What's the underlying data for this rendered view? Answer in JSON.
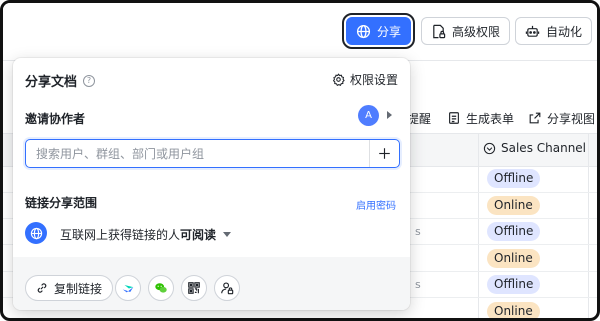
{
  "toolbar": {
    "share_label": "分享",
    "advanced_permissions_label": "高级权限",
    "automation_label": "自动化"
  },
  "table_toolbar": {
    "remind_partial": "提醒",
    "generate_form_label": "生成表单",
    "share_view_label": "分享视图"
  },
  "table": {
    "column_header": "Sales Channel",
    "rows": [
      "Offline",
      "Online",
      "Offline",
      "Online",
      "Offline",
      "Online"
    ],
    "left_fragments": [
      "s",
      "s"
    ]
  },
  "share_panel": {
    "title": "分享文档",
    "help_glyph": "?",
    "permission_settings_label": "权限设置",
    "invite_label": "邀请协作者",
    "avatar_initial": "A",
    "search_placeholder": "搜索用户、群组、部门或用户组",
    "search_value": "",
    "link_scope_label": "链接分享范围",
    "enable_password_label": "启用密码",
    "link_scope_text": "互联网上获得链接的人",
    "link_scope_permission": "可阅读",
    "copy_link_label": "复制链接"
  },
  "colors": {
    "accent": "#3370ff",
    "offline_tag": "#dfe5ff",
    "online_tag": "#fbe4c2",
    "footer_bg": "#f5f6f7"
  },
  "icons": [
    "globe-icon",
    "document-lock-icon",
    "robot-icon",
    "help-icon",
    "gear-icon",
    "plus-icon",
    "link-icon",
    "lark-icon",
    "wechat-icon",
    "qrcode-icon",
    "user-lock-icon",
    "form-icon",
    "share-view-icon",
    "status-icon"
  ]
}
